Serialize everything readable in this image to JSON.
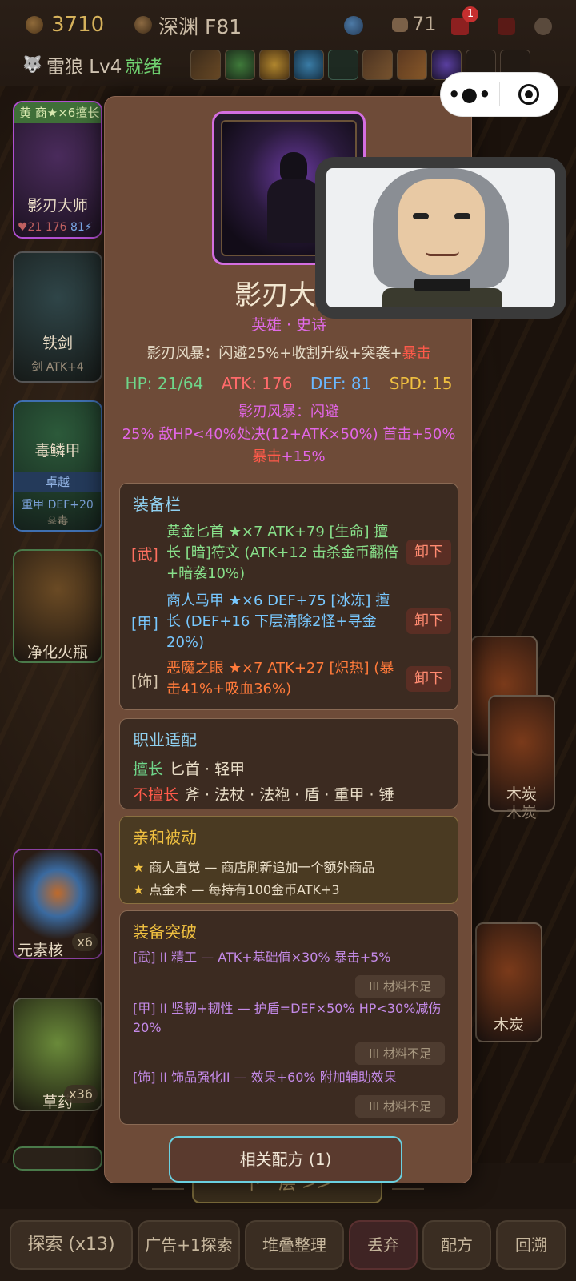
{
  "topbar": {
    "gold": "3710",
    "depth": "深渊 F81",
    "bag_count": "71",
    "gift_badge": "1",
    "hero_name": "雷狼 Lv4",
    "hero_status": "就绪"
  },
  "inventory": [
    {
      "name": "影刃大师",
      "tag": "黄 商★×6擅长",
      "stats_hp": "♥21",
      "stats_atk": "176",
      "stats_def": "81⚡"
    },
    {
      "name": "铁剑",
      "sub": "剑 ATK+4"
    },
    {
      "name": "毒鳞甲",
      "band": "卓越",
      "sub": "重甲 DEF+20",
      "sub2": "☠毒"
    },
    {
      "name": "净化火瓶"
    },
    {
      "name": "元素核",
      "count": "x6"
    },
    {
      "name": "草药",
      "count": "x36"
    }
  ],
  "right_cards": [
    {
      "name": "木炭"
    },
    {
      "name": "木炭"
    },
    {
      "name": "木炭"
    },
    {
      "name": "木炭"
    }
  ],
  "modal": {
    "name": "影刃大师",
    "rank": "英雄 · 史诗",
    "skill_line_prefix": "影刃风暴：闪避25%+收割升级+突袭+",
    "skill_line_crit": "暴击",
    "stats": {
      "hp": "HP: 21/64",
      "atk": "ATK: 176",
      "def": "DEF: 81",
      "spd": "SPD: 15"
    },
    "skill_desc_1": "影刃风暴：闪避",
    "skill_desc_2": "25% 敌HP<40%处决(12+ATK×50%) 首击+50%",
    "skill_desc_crit": "暴击",
    "skill_desc_3": "+15%",
    "equipment": {
      "title": "装备栏",
      "items": [
        {
          "slot": "[武]",
          "text": "黄金匕首 ★×7  ATK+79 [生命] 擅长 [暗]符文 (ATK+12 击杀金币翻倍+暗袭10%)",
          "action": "卸下"
        },
        {
          "slot": "[甲]",
          "text": "商人马甲 ★×6  DEF+75 [冰冻] 擅长 (DEF+16 下层清除2怪+寻金20%)",
          "action": "卸下"
        },
        {
          "slot": "[饰]",
          "text": "恶魔之眼 ★×7  ATK+27 [炽热] (暴击41%+吸血36%)",
          "action": "卸下"
        }
      ]
    },
    "class_fit": {
      "title": "职业适配",
      "good_label": "擅长",
      "good": "匕首 · 轻甲",
      "bad_label": "不擅长",
      "bad": "斧 · 法杖 · 法袍 · 盾 · 重甲 · 锤"
    },
    "affinity": {
      "title": "亲和被动",
      "items": [
        "商人直觉 — 商店刷新追加一个额外商品",
        "点金术 — 每持有100金币ATK+3"
      ]
    },
    "breakthrough": {
      "title": "装备突破",
      "items": [
        {
          "text": "[武] II 精工 — ATK+基础值×30% 暴击+5%",
          "status": "III 材料不足"
        },
        {
          "text": "[甲] II 坚韧+韧性 — 护盾=DEF×50% HP<30%减伤20%",
          "status": "III 材料不足"
        },
        {
          "text": "[饰] II 饰品强化II — 效果+60% 附加辅助效果",
          "status": "III 材料不足"
        }
      ]
    },
    "recipes_button": "相关配方 (1)"
  },
  "bottom": {
    "next_floor": "下一层 >>",
    "buttons": [
      "探索 (x13)",
      "广告+1探索",
      "堆叠整理",
      "丢弃",
      "配方",
      "回溯"
    ]
  },
  "icons": [
    "coin-icon",
    "depth-icon",
    "orb-icon",
    "bag-icon",
    "gift-icon",
    "wolf-icon",
    "more-dots-icon",
    "close-target-icon",
    "star-icon"
  ]
}
